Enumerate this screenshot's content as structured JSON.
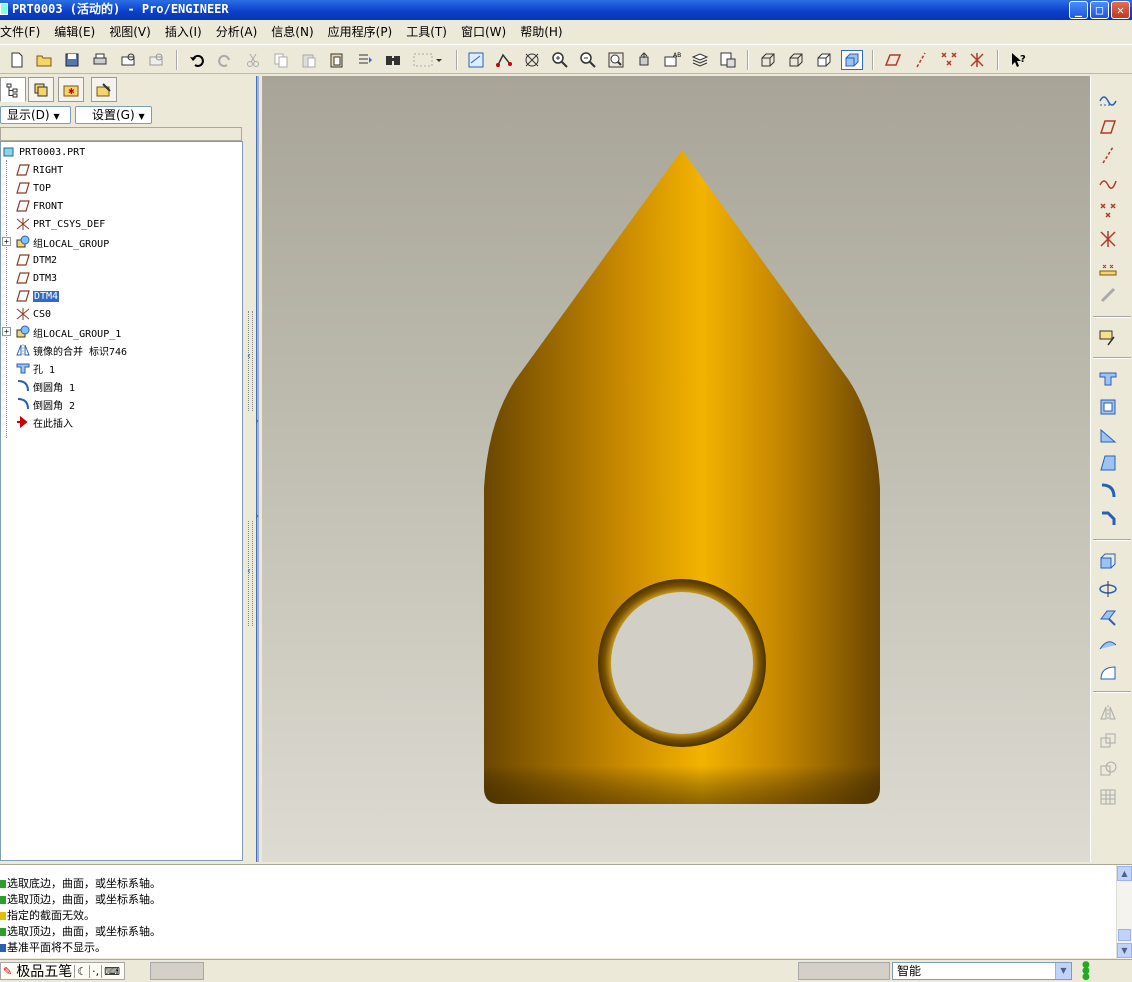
{
  "window": {
    "title": "PRT0003 (活动的) - Pro/ENGINEER"
  },
  "menubar": [
    "文件(F)",
    "编辑(E)",
    "视图(V)",
    "插入(I)",
    "分析(A)",
    "信息(N)",
    "应用程序(P)",
    "工具(T)",
    "窗口(W)",
    "帮助(H)"
  ],
  "toolbar": {
    "icons": [
      "new-file-icon",
      "open-file-icon",
      "save-icon",
      "print-icon",
      "mail-icon",
      "mail-attach-icon",
      "undo-icon",
      "redo-icon",
      "cut-icon",
      "copy-icon",
      "paste-icon",
      "paste-special-icon",
      "regenerate-icon",
      "find-icon",
      "select-box-icon",
      "datum-plane-display-icon",
      "datum-axis-display-icon",
      "datum-point-display-icon",
      "zoom-in-icon",
      "zoom-out-icon",
      "refit-icon",
      "reorient-icon",
      "saved-views-icon",
      "layers-icon",
      "view-manager-icon",
      "wireframe-icon",
      "hidden-line-icon",
      "no-hidden-icon",
      "shading-icon",
      "plane-toggle-icon",
      "axis-toggle-icon",
      "point-toggle-icon",
      "csys-toggle-icon",
      "context-help-icon"
    ]
  },
  "panel": {
    "show_button": "显示(D)",
    "settings_button": "设置(G)",
    "tabs": [
      "model-tree-tab",
      "layer-tree-tab",
      "favorites-tab",
      "folder-tab"
    ]
  },
  "tree": {
    "root": "PRT0003.PRT",
    "items": [
      {
        "label": "RIGHT",
        "icon": "datum-plane-icon",
        "selected": false,
        "expandable": false
      },
      {
        "label": "TOP",
        "icon": "datum-plane-icon",
        "selected": false,
        "expandable": false
      },
      {
        "label": "FRONT",
        "icon": "datum-plane-icon",
        "selected": false,
        "expandable": false
      },
      {
        "label": "PRT_CSYS_DEF",
        "icon": "csys-icon",
        "selected": false,
        "expandable": false
      },
      {
        "label": "组LOCAL_GROUP",
        "icon": "group-icon",
        "selected": false,
        "expandable": true
      },
      {
        "label": "DTM2",
        "icon": "datum-plane-icon",
        "selected": false,
        "expandable": false
      },
      {
        "label": "DTM3",
        "icon": "datum-plane-icon",
        "selected": false,
        "expandable": false
      },
      {
        "label": "DTM4",
        "icon": "datum-plane-icon",
        "selected": true,
        "expandable": false
      },
      {
        "label": "CS0",
        "icon": "csys-icon",
        "selected": false,
        "expandable": false
      },
      {
        "label": "组LOCAL_GROUP_1",
        "icon": "group-icon",
        "selected": false,
        "expandable": true
      },
      {
        "label": "镜像的合并 标识746",
        "icon": "mirror-merge-icon",
        "selected": false,
        "expandable": false
      },
      {
        "label": "孔 1",
        "icon": "hole-icon",
        "selected": false,
        "expandable": false
      },
      {
        "label": "倒圆角 1",
        "icon": "round-icon",
        "selected": false,
        "expandable": false
      },
      {
        "label": "倒圆角 2",
        "icon": "round-icon",
        "selected": false,
        "expandable": false
      },
      {
        "label": "在此插入",
        "icon": "insert-here-arrow-icon",
        "selected": false,
        "expandable": false
      }
    ]
  },
  "messages": [
    {
      "text": "选取底边，曲面，或坐标系轴。",
      "type": "prompt"
    },
    {
      "text": "选取顶边，曲面，或坐标系轴。",
      "type": "prompt"
    },
    {
      "text": "指定的截面无效。",
      "type": "warning"
    },
    {
      "text": "选取顶边，曲面，或坐标系轴。",
      "type": "prompt"
    },
    {
      "text": "基准平面将不显示。",
      "type": "info"
    }
  ],
  "statusbar": {
    "ime_label": "极品五笔",
    "filter_value": "智能"
  },
  "colors": {
    "part_gold": "#f0b000",
    "part_shadow": "#6a4600",
    "selection": "#316ac5"
  }
}
